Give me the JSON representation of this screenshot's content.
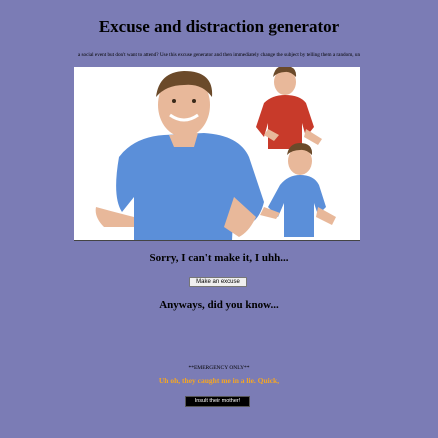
{
  "header": {
    "title": "Excuse and distraction generator"
  },
  "intro": {
    "text": "a social event but don't want to attend? Use this excuse generator and then immediately change the subject by telling them a random, un"
  },
  "excuse": {
    "text": "Sorry, I can't make it, I uhh...",
    "button_label": "Make an excuse"
  },
  "distraction": {
    "text": "Anyways, did you know..."
  },
  "emergency": {
    "label": "**EMERGENCY ONLY**",
    "subtitle": "Uh oh, they caught me in a lie. Quick,",
    "button_label": "Insult their mother!"
  },
  "colors": {
    "background": "#7b7cb5",
    "emergency_text": "#f5a623",
    "shirt_blue": "#5b8fd9",
    "shirt_red": "#c83a2a"
  }
}
